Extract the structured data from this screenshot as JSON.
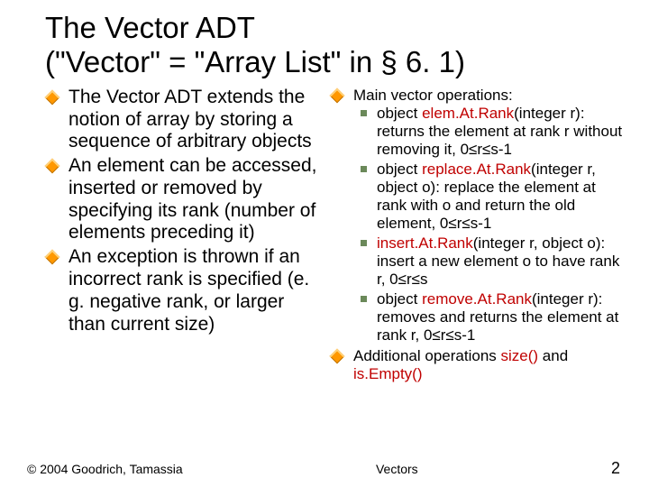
{
  "title_line1": "The Vector ADT",
  "title_line2": "(\"Vector\" = \"Array List\" in § 6. 1)",
  "left": {
    "b1": "The Vector ADT extends the notion of array by storing a sequence of arbitrary objects",
    "b2": "An element can be accessed, inserted or removed by specifying its rank (number of elements preceding it)",
    "b3": "An exception is thrown if an incorrect rank is specified (e. g. negative rank, or larger than current size)"
  },
  "right": {
    "b1": "Main vector operations:",
    "s1a": "object ",
    "s1op": "elem.At.Rank",
    "s1b": "(integer r): returns the element at rank r without removing it, 0≤r≤s-1",
    "s2a": "object ",
    "s2op": "replace.At.Rank",
    "s2b": "(integer r, object o): replace the element at rank with o and return the old element, 0≤r≤s-1",
    "s3op": "insert.At.Rank",
    "s3b": "(integer r, object o): insert a new element o to have rank r, 0≤r≤s",
    "s4a": "object ",
    "s4op": "remove.At.Rank",
    "s4b": "(integer r): removes and returns the element at rank r, 0≤r≤s-1",
    "b2a": "Additional operations ",
    "b2op1": "size()",
    "b2b": " and ",
    "b2op2": "is.Empty()"
  },
  "footer": {
    "copyright": "© 2004 Goodrich, Tamassia",
    "center": "Vectors",
    "page": "2"
  }
}
